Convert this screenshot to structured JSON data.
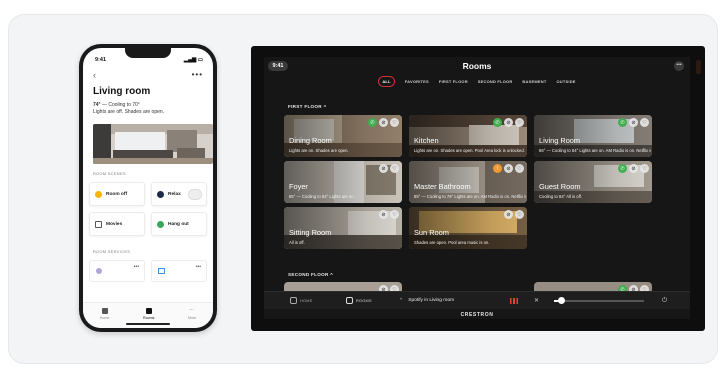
{
  "phone": {
    "time": "9:41",
    "title": "Living room",
    "status_temp": "74°",
    "status_rest": " — Cooling to 70°",
    "status_line2": "Lights are off. Shades are open.",
    "section_scenes": "ROOM SCENES",
    "scenes": [
      {
        "label": "Room off",
        "icon": "sun-icon",
        "color": "#f5b400"
      },
      {
        "label": "Relax",
        "icon": "check-icon",
        "color": "#1f2a44"
      },
      {
        "label": "Movies",
        "icon": "tv-icon",
        "color": "#555555"
      },
      {
        "label": "Hang out",
        "icon": "music-note-icon",
        "color": "#3aa55d"
      }
    ],
    "section_services": "ROOM SERVICES",
    "tabs": [
      {
        "label": "Home"
      },
      {
        "label": "Rooms"
      },
      {
        "label": "More"
      }
    ]
  },
  "tablet": {
    "time": "9:41",
    "title": "Rooms",
    "tabs": [
      {
        "label": "ALL",
        "active": true
      },
      {
        "label": "FAVORITES",
        "active": false
      },
      {
        "label": "FIRST FLOOR",
        "active": false
      },
      {
        "label": "SECOND FLOOR",
        "active": false
      },
      {
        "label": "BASEMENT",
        "active": false
      },
      {
        "label": "OUTSIDE",
        "active": false
      }
    ],
    "section_first": "FIRST FLOOR ^",
    "section_second": "SECOND FLOOR ^",
    "rooms": [
      {
        "name": "Dining Room",
        "status": "Lights are on. Shades are open.",
        "bg": "#b9a58e"
      },
      {
        "name": "Kitchen",
        "status": "Lights are on. Shades are open. Pool Area lock is unlocked.",
        "bg": "#8d7a68"
      },
      {
        "name": "Living Room",
        "status": "86° — Cooling to 84°  Lights are on. AM Radio is on. Netflix is...",
        "bg": "#7e776f"
      },
      {
        "name": "Foyer",
        "status": "85° — Cooling to 84°  Lights are on.",
        "bg": "#c9c2b7"
      },
      {
        "name": "Master Bathroom",
        "status": "85° — Cooling to 76°  Lights are on. AM Radio is on. Netflix is...",
        "bg": "#a89c8e"
      },
      {
        "name": "Guest Room",
        "status": "Cooling to 84°  All is off.",
        "bg": "#9d9388"
      },
      {
        "name": "Sitting Room",
        "status": "All is off.",
        "bg": "#b3ab9f"
      },
      {
        "name": "Sun Room",
        "status": "Shades are open. Pool area music is on.",
        "bg": "#6b5840"
      }
    ],
    "bottom": {
      "home": "HOME",
      "rooms": "ROOMS",
      "now_playing": "Spotify in Living room"
    },
    "brand": "CRESTRON"
  }
}
